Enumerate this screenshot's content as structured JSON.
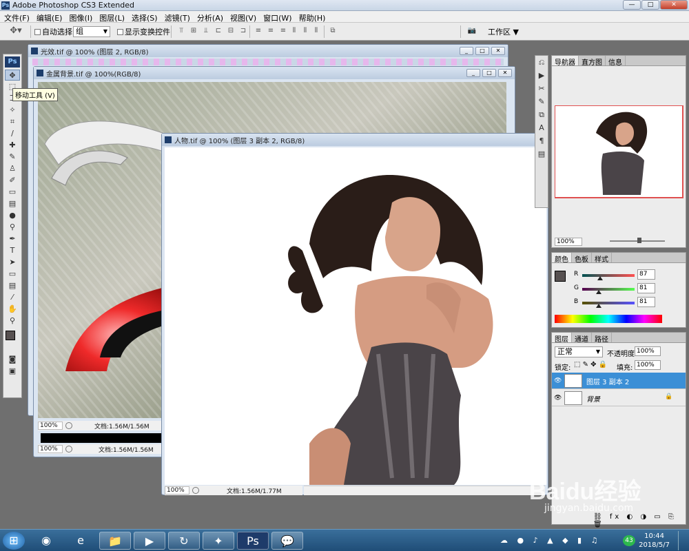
{
  "app": {
    "title": "Adobe Photoshop CS3 Extended",
    "window_controls": [
      "—",
      "□",
      "✕"
    ]
  },
  "menu": [
    "文件(F)",
    "编辑(E)",
    "图像(I)",
    "图层(L)",
    "选择(S)",
    "滤镜(T)",
    "分析(A)",
    "视图(V)",
    "窗口(W)",
    "帮助(H)"
  ],
  "options": {
    "auto_select_label": "自动选择:",
    "auto_select_value": "组",
    "show_transform_label": "显示变换控件",
    "workspace_label": "工作区 ▼"
  },
  "toolbox": {
    "logo": "Ps",
    "tooltip": "移动工具 (V)",
    "foreground_color": "#575151",
    "background_color": "#ffffff"
  },
  "documents": {
    "glow": {
      "title": "光效.tif @ 100% (图层 2, RGB/8)"
    },
    "metal_bg": {
      "title": "金属背景.tif @ 100%(RGB/8)",
      "zoom": "100%",
      "doc_info": "文档:1.56M/1.56M",
      "zoom2": "100%",
      "doc_info2": "文档:1.56M/1.56M"
    },
    "person": {
      "title": "人物.tif @ 100% (图层 3 副本 2, RGB/8)",
      "zoom": "100%",
      "doc_info": "文档:1.56M/1.77M"
    }
  },
  "navigator_panel": {
    "tabs": [
      "导航器",
      "直方图",
      "信息"
    ],
    "zoom": "100%",
    "highlight_color": "#e05050"
  },
  "color_panel": {
    "tabs": [
      "颜色",
      "色板",
      "样式"
    ],
    "r_label": "R",
    "r_value": "87",
    "g_label": "G",
    "g_value": "81",
    "b_label": "B",
    "b_value": "81",
    "swatch_color": "#575151"
  },
  "layers_panel": {
    "tabs": [
      "图层",
      "通道",
      "路径"
    ],
    "blend_mode": "正常",
    "opacity_label": "不透明度:",
    "opacity_value": "100%",
    "lock_label": "锁定:",
    "fill_label": "填充:",
    "fill_value": "100%",
    "layers": [
      {
        "name": "图层 3 副本 2",
        "selected": true
      },
      {
        "name": "背景",
        "selected": false,
        "locked": true
      }
    ]
  },
  "taskbar": {
    "time": "10:44",
    "date": "2018/5/7",
    "tray_badge": "43"
  },
  "watermark": {
    "text": "Baidu经验",
    "url": "jingyan.baidu.com"
  }
}
